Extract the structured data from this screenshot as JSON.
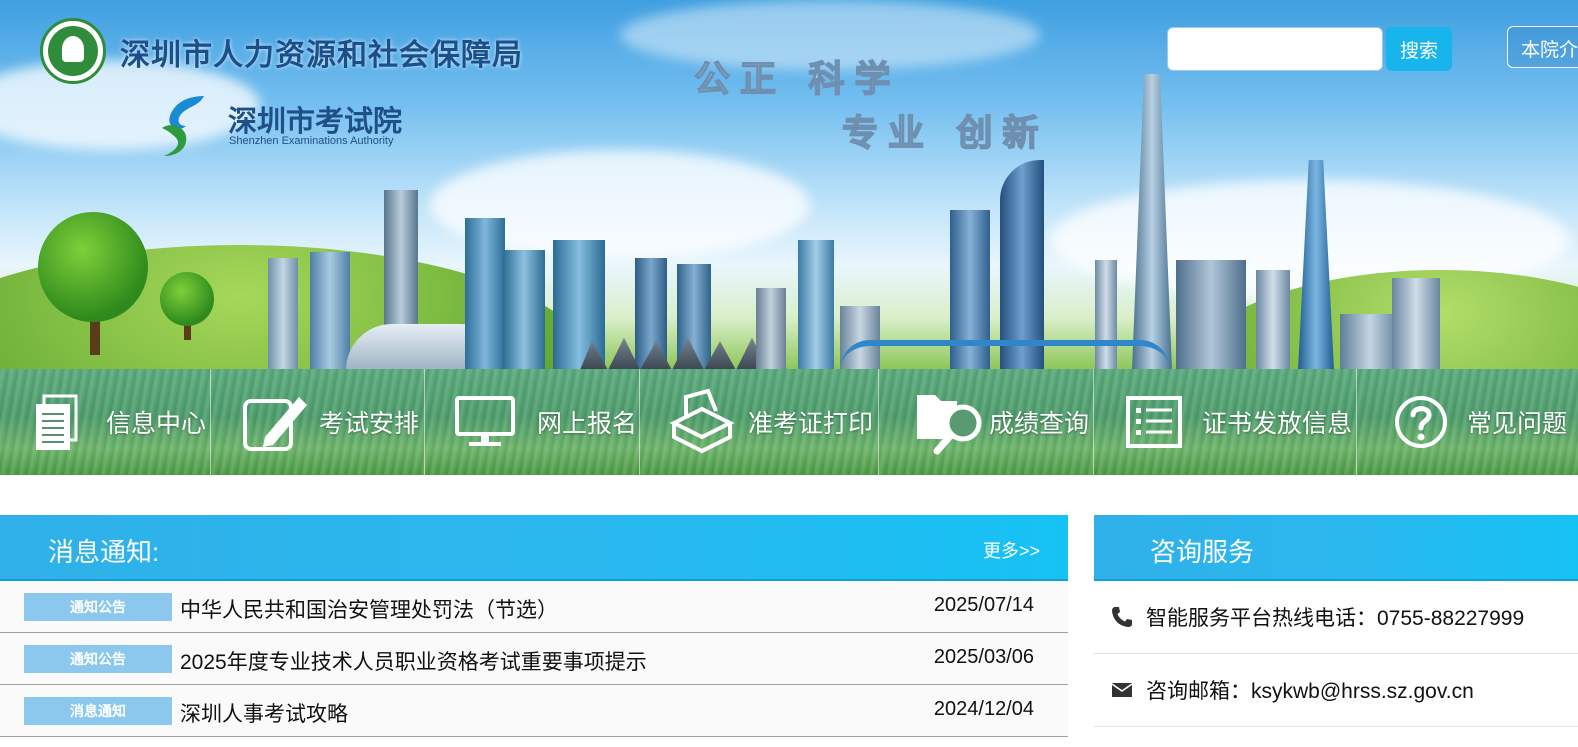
{
  "header": {
    "bureau_name": "深圳市人力资源和社会保障局",
    "authority_name": "深圳市考试院",
    "authority_name_en": "Shenzhen Examinations Authority",
    "slogan_line1": "公正 科学",
    "slogan_line2": "专业 创新",
    "search": {
      "placeholder": "",
      "button_label": "搜索"
    },
    "about_button_label": "本院介绍"
  },
  "nav": {
    "items": [
      {
        "label": "信息中心",
        "icon": "document-icon"
      },
      {
        "label": "考试安排",
        "icon": "edit-pencil-icon"
      },
      {
        "label": "网上报名",
        "icon": "monitor-icon"
      },
      {
        "label": "准考证打印",
        "icon": "printer-icon"
      },
      {
        "label": "成绩查询",
        "icon": "folder-search-icon"
      },
      {
        "label": "证书发放信息",
        "icon": "list-icon"
      },
      {
        "label": "常见问题",
        "icon": "question-icon"
      }
    ]
  },
  "notices": {
    "title": "消息通知:",
    "more_label": "更多>>",
    "items": [
      {
        "tag": "通知公告",
        "title": "中华人民共和国治安管理处罚法（节选）",
        "date": "2025/07/14"
      },
      {
        "tag": "通知公告",
        "title": "2025年度专业技术人员职业资格考试重要事项提示",
        "date": "2025/03/06"
      },
      {
        "tag": "消息通知",
        "title": "深圳人事考试攻略",
        "date": "2024/12/04"
      }
    ]
  },
  "consult": {
    "title": "咨询服务",
    "items": [
      {
        "icon": "phone-icon",
        "text": "智能服务平台热线电话：0755-88227999"
      },
      {
        "icon": "mail-icon",
        "text": "咨询邮箱：ksykwb@hrss.sz.gov.cn"
      }
    ]
  },
  "colors": {
    "accent": "#18b4ec",
    "nav_green": "#4e9c6c",
    "badge": "#8cc8ee",
    "brand_blue": "#1c4f8a"
  }
}
